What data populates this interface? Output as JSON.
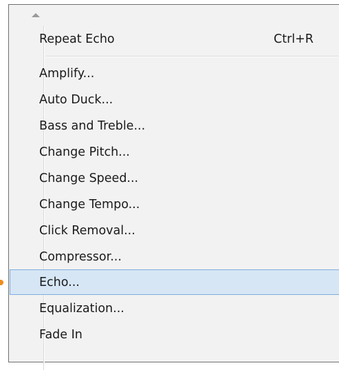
{
  "menu": {
    "repeat": {
      "label": "Repeat Echo",
      "shortcut": "Ctrl+R"
    },
    "items": [
      {
        "label": "Amplify..."
      },
      {
        "label": "Auto Duck..."
      },
      {
        "label": "Bass and Treble..."
      },
      {
        "label": "Change Pitch..."
      },
      {
        "label": "Change Speed..."
      },
      {
        "label": "Change Tempo..."
      },
      {
        "label": "Click Removal..."
      },
      {
        "label": "Compressor..."
      },
      {
        "label": "Echo..."
      },
      {
        "label": "Equalization..."
      },
      {
        "label": "Fade In"
      }
    ],
    "highlighted_label": "Echo...",
    "colors": {
      "highlight_bg": "#d6e6f5",
      "highlight_border": "#7eaede",
      "marker": "#f08c1c"
    },
    "icons": {
      "scroll_up": "scroll-up-arrow-icon"
    }
  }
}
